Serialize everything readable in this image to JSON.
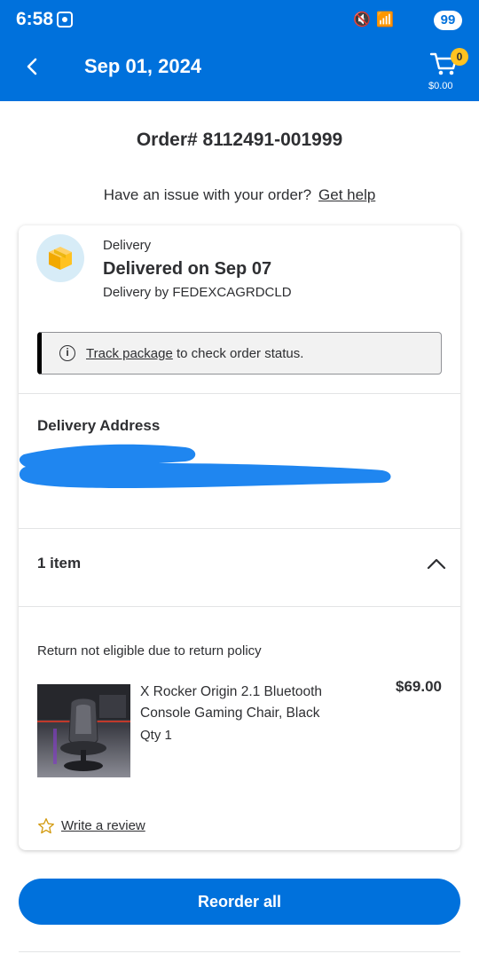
{
  "status_bar": {
    "time": "6:58",
    "battery": "99"
  },
  "header": {
    "title": "Sep 01, 2024",
    "cart_count": "0",
    "cart_total": "$0.00"
  },
  "order": {
    "number": "Order# 8112491-001999"
  },
  "help": {
    "question": "Have an issue with your order?",
    "link": "Get help"
  },
  "delivery": {
    "label": "Delivery",
    "status": "Delivered on Sep 07",
    "carrier": "Delivery by FEDEXCAGRDCLD",
    "track_link": "Track package",
    "track_suffix": "to check order status."
  },
  "address": {
    "title": "Delivery Address"
  },
  "items": {
    "count_label": "1 item",
    "return_note": "Return not eligible due to return policy",
    "list": [
      {
        "name": "X Rocker Origin 2.1 Bluetooth Console Gaming Chair, Black",
        "qty": "Qty 1",
        "price": "$69.00"
      }
    ],
    "review_link": "Write a review"
  },
  "actions": {
    "reorder": "Reorder all"
  },
  "colors": {
    "brand_blue": "#0071dc",
    "spark_yellow": "#ffc220",
    "text": "#2e2f32"
  }
}
